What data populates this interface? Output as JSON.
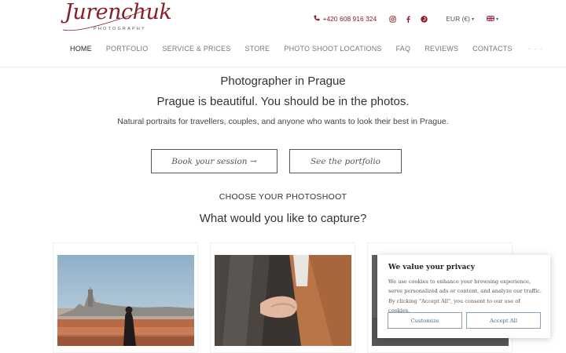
{
  "brand": {
    "script": "Jurenchuk",
    "sub": "PHOTOGRAPHY",
    "color": "#8a1f2b"
  },
  "topbar": {
    "phone": "+420 608 916 324",
    "currency": "EUR (€)",
    "icons": [
      "phone-icon",
      "instagram-icon",
      "facebook-icon",
      "pinterest-icon",
      "uk-flag-icon"
    ]
  },
  "nav": {
    "items": [
      "HOME",
      "PORTFOLIO",
      "SERVICE & PRICES",
      "STORE",
      "PHOTO SHOOT LOCATIONS",
      "FAQ",
      "REVIEWS",
      "CONTACTS"
    ],
    "more": "· · ·"
  },
  "hero": {
    "title": "Photographer in Prague",
    "subtitle": "Prague is beautiful. You should be in the photos.",
    "description": "Natural portraits for travellers, couples, and anyone who wants to look their best in Prague.",
    "book_label": "Book your session →",
    "portfolio_label": "See the portfolio"
  },
  "section": {
    "choose": "CHOOSE YOUR PHOTOSHOOT",
    "capture": "What would you like to capture?"
  },
  "cookie": {
    "title": "We value your privacy",
    "text": "We use cookies to enhance your browsing experience, serve personalized ads or content, and analyze our traffic. By clicking \"Accept All\", you consent to our use of cookies.",
    "customize_label": "Customize",
    "accept_label": "Accept All"
  }
}
